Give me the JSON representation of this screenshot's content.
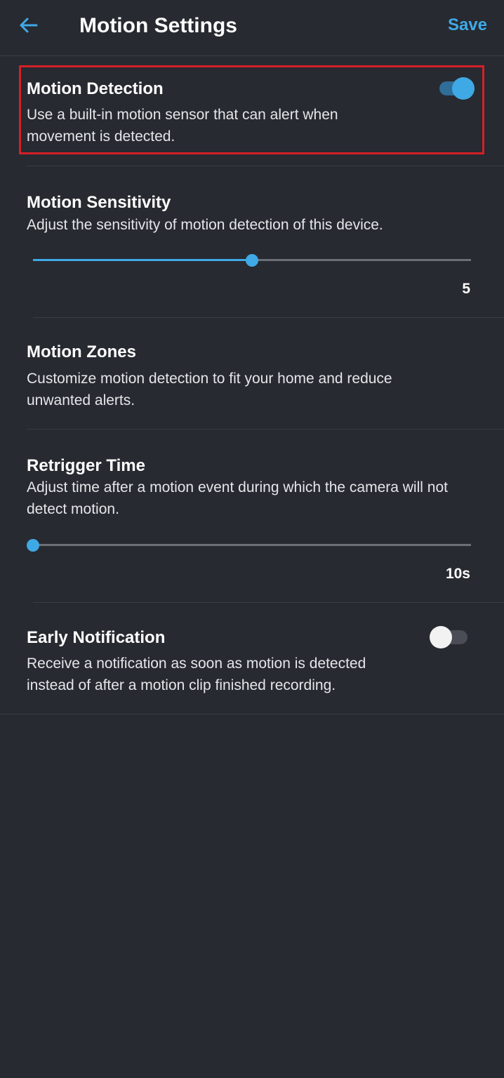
{
  "header": {
    "title": "Motion Settings",
    "save_label": "Save",
    "back_icon": "arrow-left-icon"
  },
  "colors": {
    "accent": "#3fa9e6",
    "background": "#272a30",
    "highlight": "#d51f27"
  },
  "motion_detection": {
    "title": "Motion Detection",
    "desc_line1": "Use a built-in motion sensor that can alert when",
    "desc_line2": "movement is detected.",
    "enabled": true
  },
  "motion_sensitivity": {
    "title": "Motion Sensitivity",
    "desc": "Adjust the sensitivity of motion detection of this device.",
    "value_label": "5",
    "level_fraction": 0.5
  },
  "motion_zones": {
    "title": "Motion Zones",
    "desc_line1": "Customize motion detection to fit your home and reduce",
    "desc_line2": "unwanted alerts."
  },
  "retrigger_time": {
    "title": "Retrigger Time",
    "desc_line1": "Adjust time after a motion event during which the camera will not",
    "desc_line2": "detect motion.",
    "value_label": "10s",
    "level_fraction": 0.0
  },
  "early_notification": {
    "title": "Early Notification",
    "desc_line1": "Receive a notification as soon as motion is detected",
    "desc_line2": "instead of after a motion clip finished recording.",
    "enabled": false
  }
}
